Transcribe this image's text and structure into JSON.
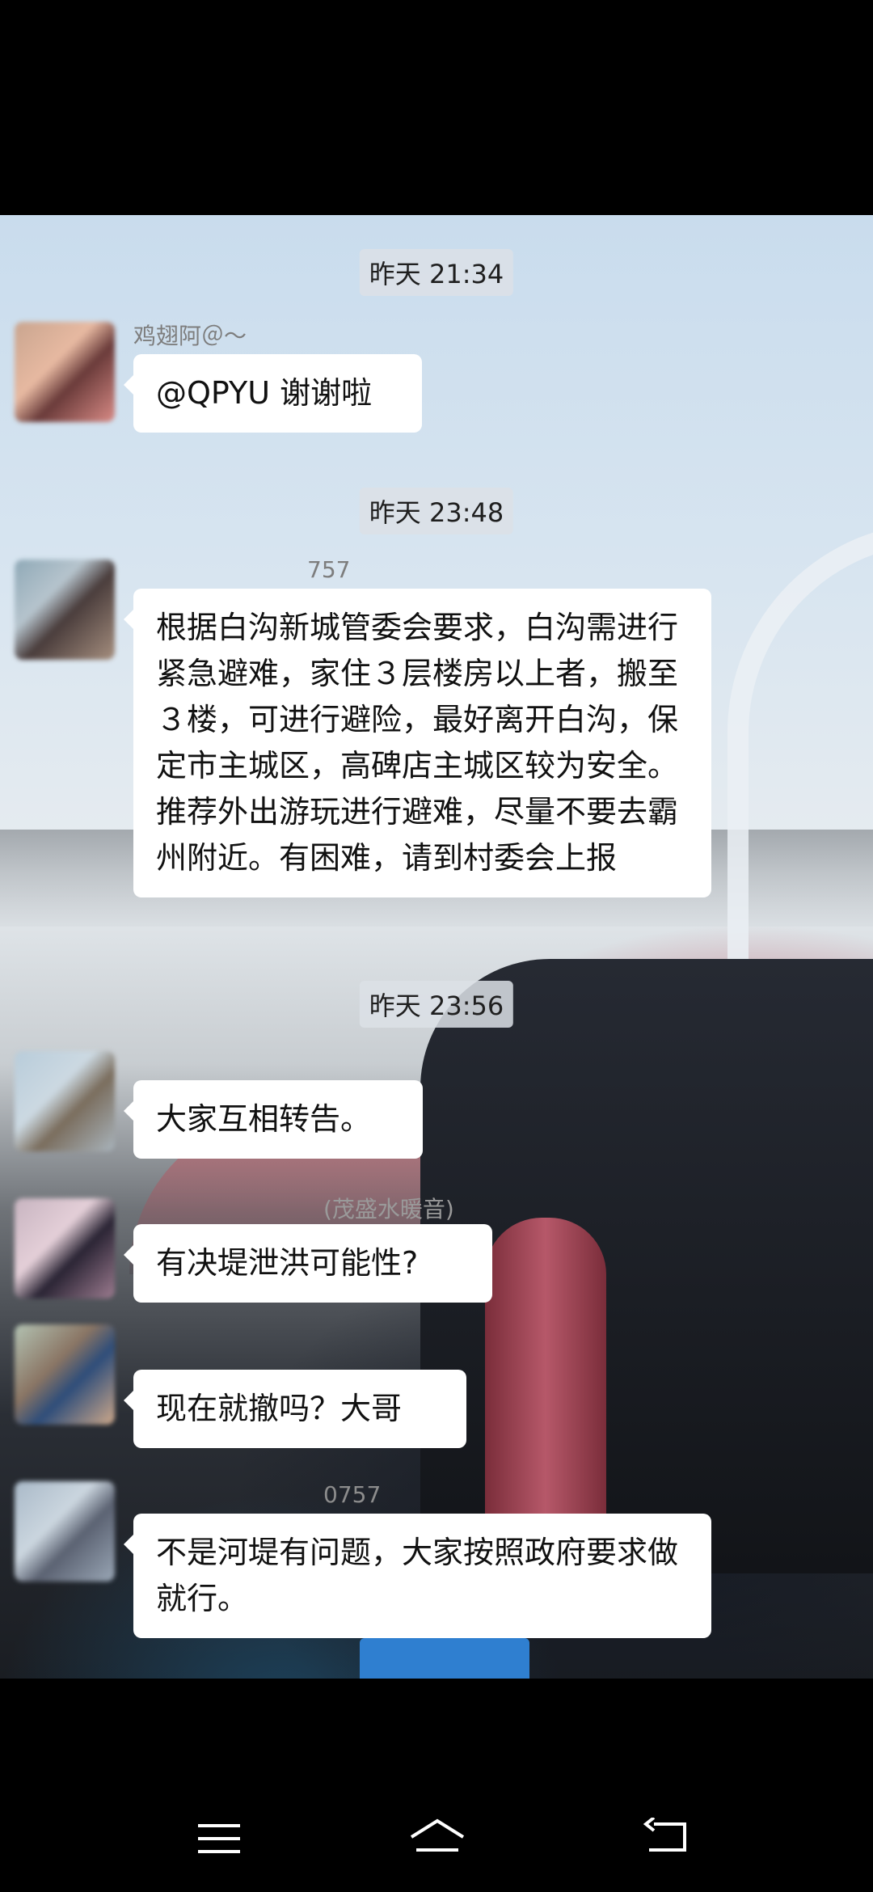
{
  "messages": [
    {
      "timestamp": "昨天 21:34",
      "sender": "鸡翅阿＠～",
      "text": "@QPYU 谢谢啦"
    },
    {
      "timestamp": "昨天 23:48",
      "sender": "757",
      "text": "根据白沟新城管委会要求，白沟需进行紧急避难，家住３层楼房以上者，搬至３楼，可进行避险，最好离开白沟，保定市主城区，高碑店主城区较为安全。推荐外出游玩进行避难，尽量不要去霸州附近。有困难，请到村委会上报"
    },
    {
      "timestamp": "昨天 23:56",
      "sender": "",
      "text": "大家互相转告。"
    },
    {
      "sender": "(茂盛水暖音)",
      "text": "有决堤泄洪可能性?"
    },
    {
      "sender": "",
      "text": "现在就撤吗？大哥"
    },
    {
      "sender": "0757",
      "text": "不是河堤有问题，大家按照政府要求做就行。"
    }
  ],
  "nav": {
    "menu_icon": "menu-icon",
    "home_icon": "home-icon",
    "back_icon": "back-icon"
  }
}
